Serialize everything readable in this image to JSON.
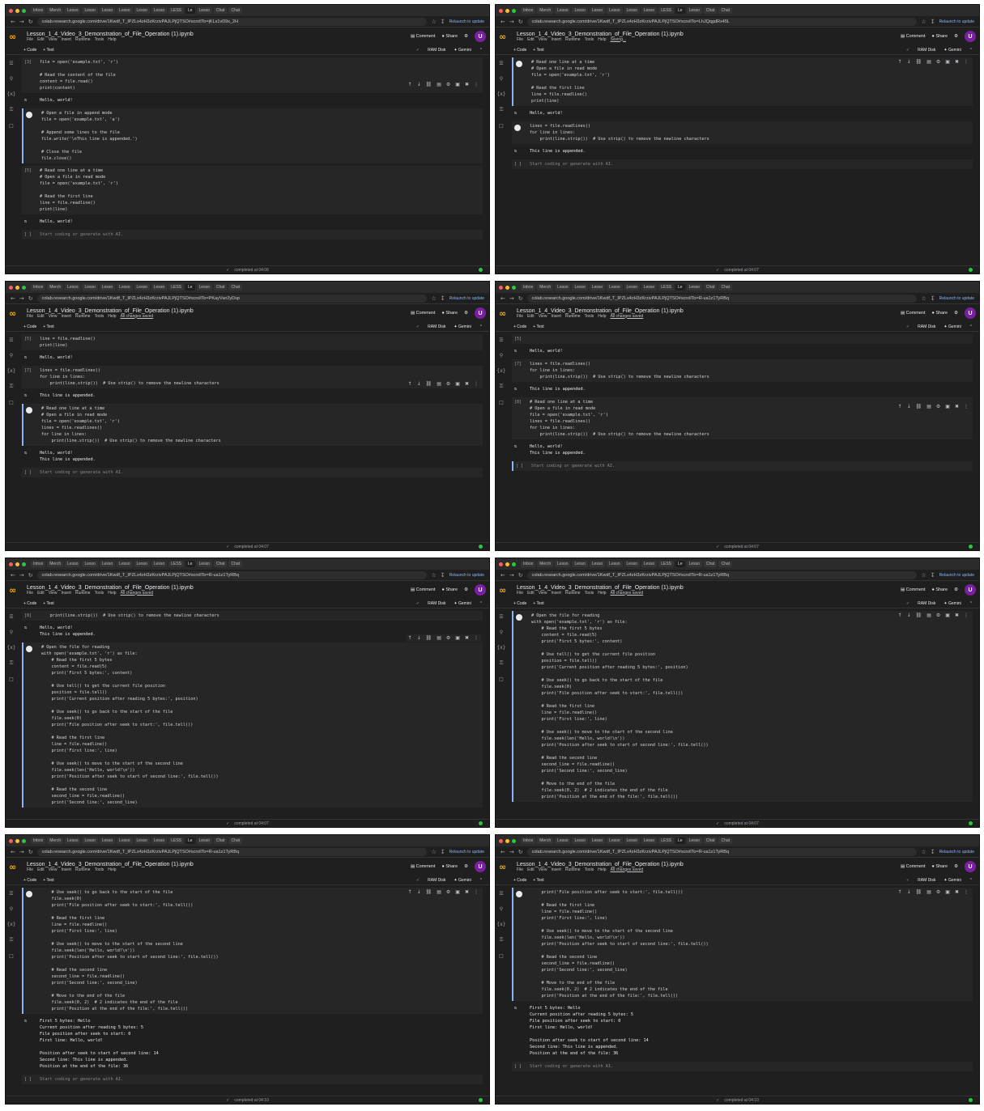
{
  "browser": {
    "tabs": [
      "Inbox",
      "Merch",
      "Lesso",
      "Lesso",
      "Lesso",
      "Lesso",
      "Lesso",
      "Lesso",
      "LESS",
      "Le",
      "Lesso",
      "Chat",
      "Chat"
    ],
    "relaunch_label": "Relaunch to update"
  },
  "notebook": {
    "name": "Lesson_1_4_Video_3_Demonstration_of_File_Operation (1).ipynb",
    "menus": [
      "File",
      "Edit",
      "View",
      "Insert",
      "Runtime",
      "Tools",
      "Help"
    ],
    "comment_label": "Comment",
    "share_label": "Share",
    "avatar": "U",
    "add_code_label": "+ Code",
    "add_text_label": "+ Text",
    "ram_label": "RAM Disk",
    "gemini_label": "Gemini",
    "empty_prompt": "Start coding or generate with AI."
  },
  "frames": [
    {
      "url": "colab.research.google.com/drive/1Kwdf_T_IPZLx4zH3zKrzivPAJLPjQTSO#scrollTo=jKLs1vD9x_2H",
      "saved_label": "",
      "cells": [
        {
          "kind": "code",
          "n": "[3]",
          "code": "file = open('example.txt', 'r')\n\n# Read the content of the file\ncontent = file.read()\nprint(content)"
        },
        {
          "kind": "out",
          "text": "Hello, world!"
        },
        {
          "kind": "code",
          "n": "",
          "active": true,
          "code": "# Open a file in append mode\nfile = open('example.txt', 'a')\n\n# Append some lines to the file\nfile.write('\\nThis line is appended.')\n\n# Close the file\nfile.close()"
        },
        {
          "kind": "code",
          "n": "[5]",
          "code": "# Read one line at a time\n# Open a file in read mode\nfile = open('example.txt', 'r')\n\n# Read the first line\nline = file.readline()\nprint(line)"
        },
        {
          "kind": "out",
          "text": "Hello, world!"
        },
        {
          "kind": "empty"
        }
      ],
      "status": "completed at 04:06"
    },
    {
      "url": "colab.research.google.com/drive/1Kwdf_T_IPZLx4zH3zKrzivPAJLPjQTSO#scrollTo=LhJQqgdRx45L",
      "saved_label": "Saving...",
      "cells": [
        {
          "kind": "code",
          "n": "",
          "active": true,
          "code": "# Read one line at a time\n# Open a file in read mode\nfile = open('example.txt', 'r')\n\n# Read the first line\nline = file.readline()\nprint(line)"
        },
        {
          "kind": "out",
          "text": "Hello, world!"
        },
        {
          "kind": "code",
          "n": "",
          "code": "lines = file.readlines()\nfor line in lines:\n    print(line.strip())  # Use strip() to remove the newline characters"
        },
        {
          "kind": "out",
          "text": "This line is appended."
        },
        {
          "kind": "empty"
        }
      ],
      "status": "completed at 04:07"
    },
    {
      "url": "colab.research.google.com/drive/1Kwdf_T_IPZLx4zH3zKrzivPAJLPjQTSO#scrollTo=PKayVwr2yDsp",
      "saved_label": "All changes saved",
      "cells": [
        {
          "kind": "code",
          "n": "[5]",
          "code": "line = file.readline()\nprint(line)"
        },
        {
          "kind": "out",
          "text": "Hello, world!"
        },
        {
          "kind": "code",
          "n": "[7]",
          "code": "lines = file.readlines()\nfor line in lines:\n    print(line.strip())  # Use strip() to remove the newline characters"
        },
        {
          "kind": "out",
          "text": "This line is appended."
        },
        {
          "kind": "code",
          "n": "",
          "active": true,
          "code": "# Read one line at a time\n# Open a file in read mode\nfile = open('example.txt', 'r')\nlines = file.readlines()\nfor line in lines:\n    print(line.strip())  # Use strip() to remove the newline characters"
        },
        {
          "kind": "out",
          "text": "Hello, world!\nThis line is appended."
        },
        {
          "kind": "empty"
        }
      ],
      "status": "completed at 04:07"
    },
    {
      "url": "colab.research.google.com/drive/1Kwdf_T_IPZLx4zH3zKrzivPAJLPjQTSO#scrollTo=R-ua1z1TyRBq",
      "saved_label": "All changes saved",
      "cells": [
        {
          "kind": "code",
          "n": "[5]",
          "code": ""
        },
        {
          "kind": "out",
          "text": "Hello, world!"
        },
        {
          "kind": "code",
          "n": "[7]",
          "code": "lines = file.readlines()\nfor line in lines:\n    print(line.strip())  # Use strip() to remove the newline characters"
        },
        {
          "kind": "out",
          "text": "This line is appended."
        },
        {
          "kind": "code",
          "n": "[8]",
          "code": "# Read one line at a time\n# Open a file in read mode\nfile = open('example.txt', 'r')\nlines = file.readlines()\nfor line in lines:\n    print(line.strip())  # Use strip() to remove the newline characters"
        },
        {
          "kind": "out",
          "text": "Hello, world!\nThis line is appended."
        },
        {
          "kind": "empty",
          "active": true
        }
      ],
      "status": "completed at 04:07"
    },
    {
      "url": "colab.research.google.com/drive/1Kwdf_T_IPZLx4zH3zKrzivPAJLPjQTSO#scrollTo=R-ua1z1TyRBq",
      "saved_label": "All changes saved",
      "cells": [
        {
          "kind": "code",
          "n": "[8]",
          "code": "    print(line.strip())  # Use strip() to remove the newline characters"
        },
        {
          "kind": "out",
          "text": "Hello, world!\nThis line is appended."
        },
        {
          "kind": "code",
          "n": "",
          "active": true,
          "code": "# Open the file for reading\nwith open('example.txt', 'r') as file:\n    # Read the first 5 bytes\n    content = file.read(5)\n    print('First 5 bytes:', content)\n\n    # Use tell() to get the current file position\n    position = file.tell()\n    print('Current position after reading 5 bytes:', position)\n\n    # Use seek() to go back to the start of the file\n    file.seek(0)\n    print('File position after seek to start:', file.tell())\n\n    # Read the first line\n    line = file.readline()\n    print('First line:', line)\n\n    # Use seek() to move to the start of the second line\n    file.seek(len('Hello, world!\\n'))\n    print('Position after seek to start of second line:', file.tell())\n\n    # Read the second line\n    second_line = file.readline()\n    print('Second line:', second_line)"
        }
      ],
      "status": "completed at 04:07"
    },
    {
      "url": "colab.research.google.com/drive/1Kwdf_T_IPZLx4zH3zKrzivPAJLPjQTSO#scrollTo=R-ua1z1TyRBq",
      "saved_label": "All changes saved",
      "cells": [
        {
          "kind": "code",
          "n": "",
          "active": true,
          "code": "# Open the file for reading\nwith open('example.txt', 'r') as file:\n    # Read the first 5 bytes\n    content = file.read(5)\n    print('First 5 bytes:', content)\n\n    # Use tell() to get the current file position\n    position = file.tell()\n    print('Current position after reading 5 bytes:', position)\n\n    # Use seek() to go back to the start of the file\n    file.seek(0)\n    print('File position after seek to start:', file.tell())\n\n    # Read the first line\n    line = file.readline()\n    print('First line:', line)\n\n    # Use seek() to move to the start of the second line\n    file.seek(len('Hello, world!\\n'))\n    print('Position after seek to start of second line:', file.tell())\n\n    # Read the second line\n    second_line = file.readline()\n    print('Second line:', second_line)\n\n    # Move to the end of the file\n    file.seek(0, 2)  # 2 indicates the end of the file\n    print('Position at the end of the file:', file.tell())"
        }
      ],
      "status": "completed at 04:07"
    },
    {
      "url": "colab.research.google.com/drive/1Kwdf_T_IPZLx4zH3zKrzivPAJLPjQTSO#scrollTo=R-ua1z1TyRBq",
      "saved_label": "",
      "cells": [
        {
          "kind": "code",
          "n": "",
          "active": true,
          "code": "    # Use seek() to go back to the start of the file\n    file.seek(0)\n    print('File position after seek to start:', file.tell())\n\n    # Read the first line\n    line = file.readline()\n    print('First line:', line)\n\n    # Use seek() to move to the start of the second line\n    file.seek(len('Hello, world!\\n'))\n    print('Position after seek to start of second line:', file.tell())\n\n    # Read the second line\n    second_line = file.readline()\n    print('Second line:', second_line)\n\n    # Move to the end of the file\n    file.seek(0, 2)  # 2 indicates the end of the file\n    print('Position at the end of the file:', file.tell())"
        },
        {
          "kind": "out",
          "text": "First 5 bytes: Hello\nCurrent position after reading 5 bytes: 5\nFile position after seek to start: 0\nFirst line: Hello, world!\n\nPosition after seek to start of second line: 14\nSecond line: This line is appended.\nPosition at the end of the file: 36"
        },
        {
          "kind": "empty"
        }
      ],
      "status": "completed at 04:10"
    },
    {
      "url": "colab.research.google.com/drive/1Kwdf_T_IPZLx4zH3zKrzivPAJLPjQTSO#scrollTo=R-ua1z1TyRBq",
      "saved_label": "All changes saved",
      "cells": [
        {
          "kind": "code",
          "n": "",
          "active": true,
          "code": "    print('File position after seek to start:', file.tell())\n\n    # Read the first line\n    line = file.readline()\n    print('First line:', line)\n\n    # Use seek() to move to the start of the second line\n    file.seek(len('Hello, world!\\n'))\n    print('Position after seek to start of second line:', file.tell())\n\n    # Read the second line\n    second_line = file.readline()\n    print('Second line:', second_line)\n\n    # Move to the end of the file\n    file.seek(0, 2)  # 2 indicates the end of the file\n    print('Position at the end of the file:', file.tell())"
        },
        {
          "kind": "out",
          "text": "First 5 bytes: Hello\nCurrent position after reading 5 bytes: 5\nFile position after seek to start: 0\nFirst line: Hello, world!\n\nPosition after seek to start of second line: 14\nSecond line: This line is appended.\nPosition at the end of the file: 36"
        },
        {
          "kind": "empty"
        }
      ],
      "status": "completed at 04:10"
    }
  ]
}
